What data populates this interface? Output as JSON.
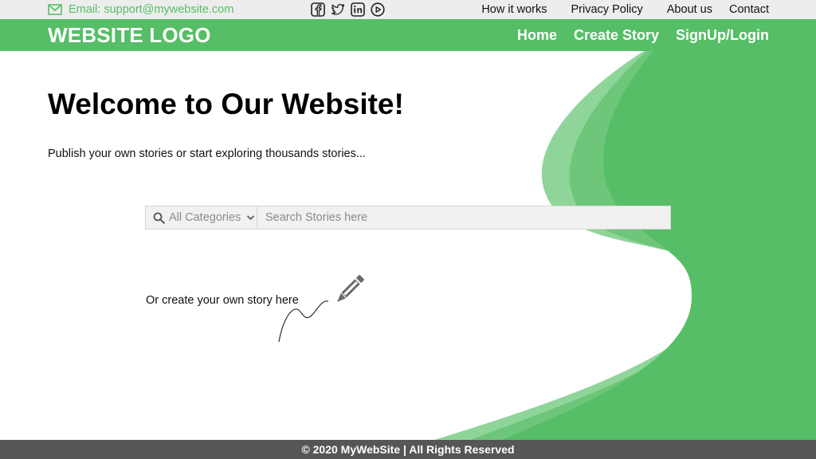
{
  "topbar": {
    "email": "Email: support@mywebsite.com",
    "icons": [
      "mail-icon",
      "facebook-icon",
      "twitter-icon",
      "linkedin-icon",
      "youtube-icon"
    ],
    "links": [
      "How it works",
      "Privacy Policy",
      "About us",
      "Contact"
    ]
  },
  "nav": {
    "logo": "WEBSITE LOGO",
    "items": [
      "Home",
      "Create Story",
      "SignUp/Login"
    ]
  },
  "hero": {
    "title": "Welcome to Our Website!",
    "subtitle": "Publish your own stories or start exploring thousands stories..."
  },
  "search": {
    "category": "All Categories",
    "placeholder": "Search Stories here",
    "icons": [
      "search-icon",
      "chevron-down-icon"
    ]
  },
  "create": {
    "text": "Or create your own story here",
    "icon": "pencil-icon"
  },
  "footer": {
    "copyright": "© 2020 MyWebSite | All Rights Reserved"
  },
  "colors": {
    "brand_green": "#55be66",
    "light_green": "#8fd59a",
    "mid_green": "#6dc679",
    "footer_gray": "#565656",
    "topbar_gray": "#ededed"
  }
}
